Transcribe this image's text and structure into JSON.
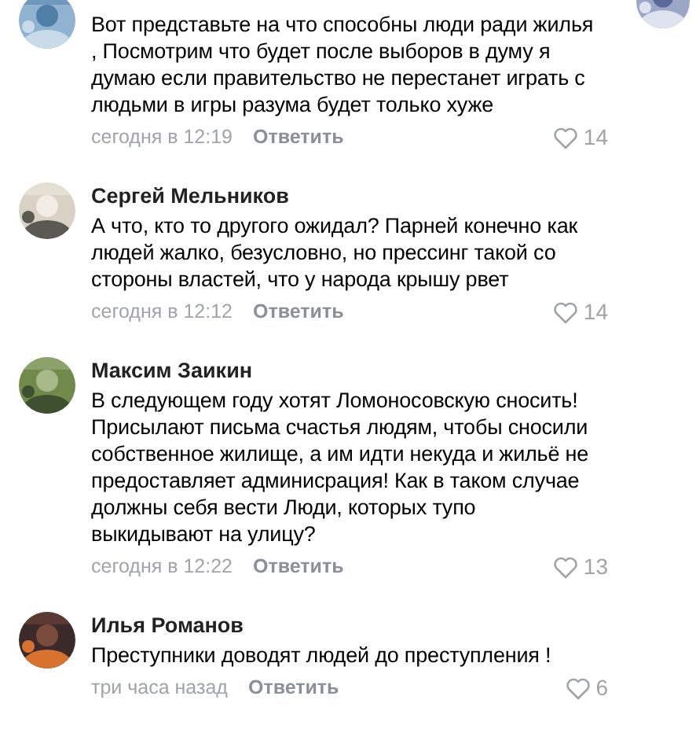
{
  "comments": [
    {
      "text": "Вот представьте на что способны люди ради жилья , Посмотрим что будет после выборов в думу я думаю если правительство не перестанет играть с людьми в игры разума будет только хуже",
      "time": "сегодня в 12:19",
      "reply": "Ответить",
      "likes": "14"
    },
    {
      "author": "Сергей Мельников",
      "text": "А что, кто то другого ожидал? Парней конечно как людей жалко, безусловно, но прессинг такой со стороны властей, что у народа крышу рвет",
      "time": "сегодня в 12:12",
      "reply": "Ответить",
      "likes": "14"
    },
    {
      "author": "Максим Заикин",
      "text": "В следующем году хотят Ломоносовскую сносить! Присылают письма счастья людям, чтобы сносили собственное жилище, а им идти некуда и жильё не предоставляет админисрация! Как в таком случае должны себя вести Люди, которых тупо выкидывают на улицу?",
      "time": "сегодня в 12:22",
      "reply": "Ответить",
      "likes": "13"
    },
    {
      "author": "Илья Романов",
      "text": "Преступники доводят людей до преступления !",
      "time": "три часа назад",
      "reply": "Ответить",
      "likes": "6"
    }
  ]
}
